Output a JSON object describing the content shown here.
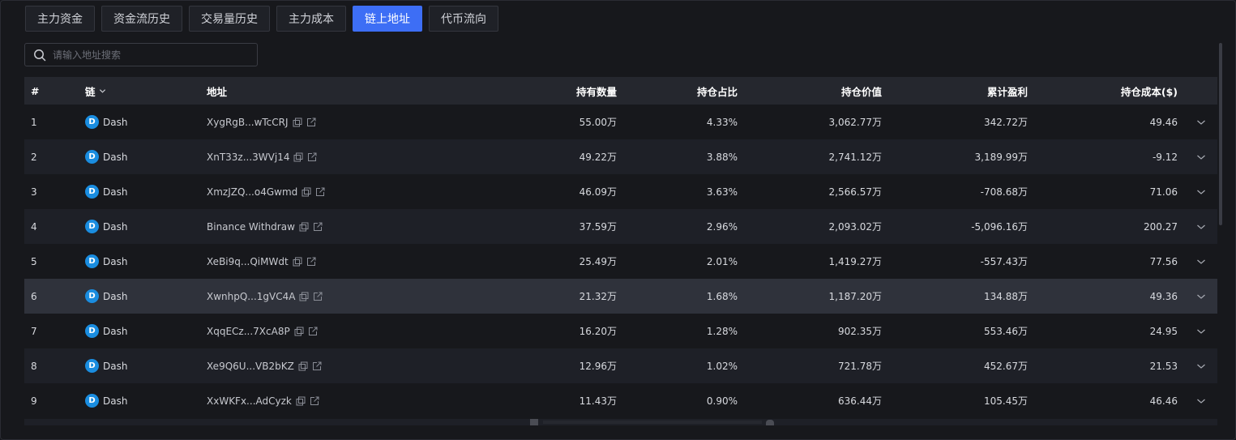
{
  "tabs": [
    {
      "label": "主力资金",
      "active": false
    },
    {
      "label": "资金流历史",
      "active": false
    },
    {
      "label": "交易量历史",
      "active": false
    },
    {
      "label": "主力成本",
      "active": false
    },
    {
      "label": "链上地址",
      "active": true
    },
    {
      "label": "代币流向",
      "active": false
    }
  ],
  "search": {
    "placeholder": "请输入地址搜索",
    "value": ""
  },
  "table": {
    "headers": {
      "index": "#",
      "chain": "链",
      "address": "地址",
      "quantity": "持有数量",
      "share": "持仓占比",
      "value": "持仓价值",
      "pnl": "累计盈利",
      "cost": "持仓成本($)"
    },
    "rows": [
      {
        "index": "1",
        "chain": "Dash",
        "address": "XygRgB...wTcCRJ",
        "quantity": "55.00万",
        "share": "4.33%",
        "value": "3,062.77万",
        "pnl": "342.72万",
        "cost": "49.46"
      },
      {
        "index": "2",
        "chain": "Dash",
        "address": "XnT33z...3WVj14",
        "quantity": "49.22万",
        "share": "3.88%",
        "value": "2,741.12万",
        "pnl": "3,189.99万",
        "cost": "-9.12"
      },
      {
        "index": "3",
        "chain": "Dash",
        "address": "XmzJZQ...o4Gwmd",
        "quantity": "46.09万",
        "share": "3.63%",
        "value": "2,566.57万",
        "pnl": "-708.68万",
        "cost": "71.06"
      },
      {
        "index": "4",
        "chain": "Dash",
        "address": "Binance Withdraw",
        "quantity": "37.59万",
        "share": "2.96%",
        "value": "2,093.02万",
        "pnl": "-5,096.16万",
        "cost": "200.27"
      },
      {
        "index": "5",
        "chain": "Dash",
        "address": "XeBi9q...QiMWdt",
        "quantity": "25.49万",
        "share": "2.01%",
        "value": "1,419.27万",
        "pnl": "-557.43万",
        "cost": "77.56"
      },
      {
        "index": "6",
        "chain": "Dash",
        "address": "XwnhpQ...1gVC4A",
        "quantity": "21.32万",
        "share": "1.68%",
        "value": "1,187.20万",
        "pnl": "134.88万",
        "cost": "49.36"
      },
      {
        "index": "7",
        "chain": "Dash",
        "address": "XqqECz...7XcA8P",
        "quantity": "16.20万",
        "share": "1.28%",
        "value": "902.35万",
        "pnl": "553.46万",
        "cost": "24.95"
      },
      {
        "index": "8",
        "chain": "Dash",
        "address": "Xe9Q6U...VB2bKZ",
        "quantity": "12.96万",
        "share": "1.02%",
        "value": "721.78万",
        "pnl": "452.67万",
        "cost": "21.53"
      },
      {
        "index": "9",
        "chain": "Dash",
        "address": "XxWKFx...AdCyzk",
        "quantity": "11.43万",
        "share": "0.90%",
        "value": "636.44万",
        "pnl": "105.45万",
        "cost": "46.46"
      }
    ]
  },
  "icons": {
    "coin": "dash-coin-icon",
    "copy": "copy-icon",
    "link": "external-link-icon",
    "expand": "chevron-down-icon",
    "search": "search-icon"
  },
  "colors": {
    "accent": "#3d6ef5",
    "background": "#17181c",
    "row_alt": "#1e2027",
    "header": "#25272e",
    "dash_blue": "#1a8de0"
  }
}
